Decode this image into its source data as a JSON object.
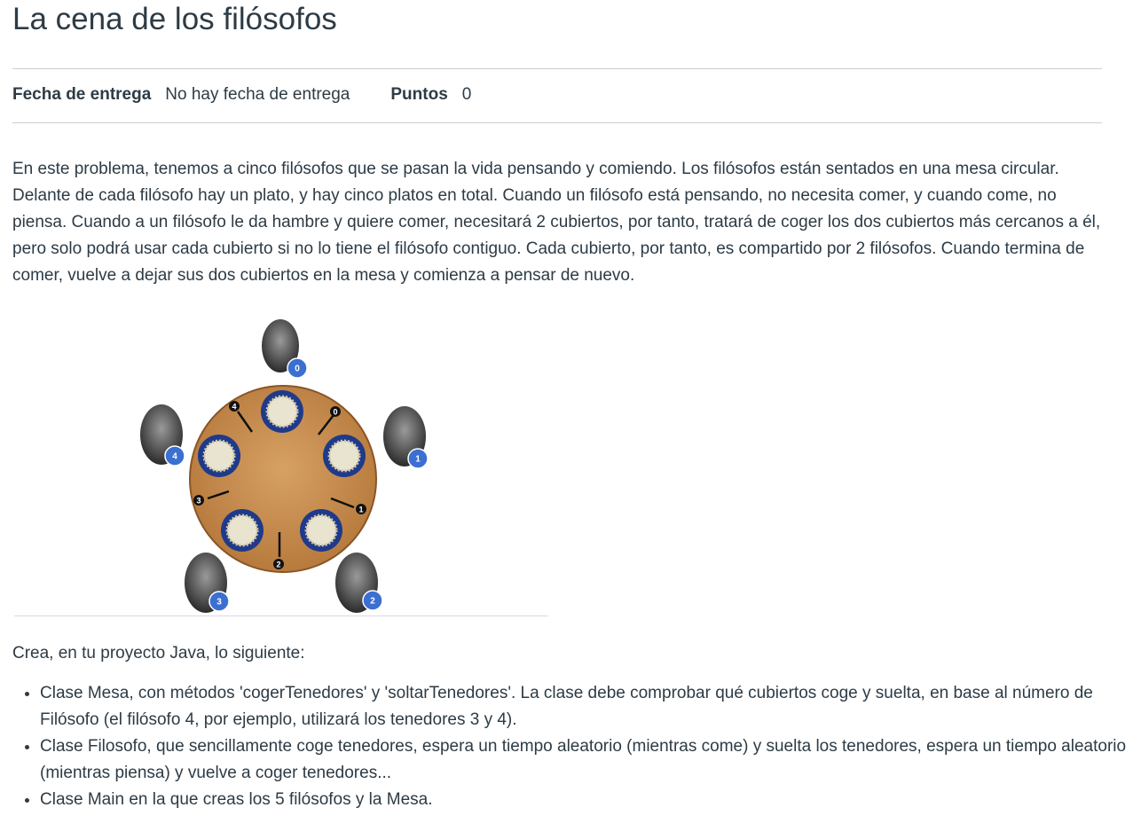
{
  "title": "La cena de los filósofos",
  "meta": {
    "due_label": "Fecha de entrega",
    "due_value": "No hay fecha de entrega",
    "points_label": "Puntos",
    "points_value": "0"
  },
  "intro": "En este problema, tenemos a cinco filósofos que se pasan la vida pensando y comiendo. Los filósofos están sentados en una mesa circular. Delante de cada filósofo hay un plato, y hay cinco platos en total. Cuando un filósofo está pensando, no necesita comer, y cuando come, no piensa. Cuando a un filósofo le da hambre y quiere comer, necesitará 2 cubiertos, por tanto, tratará de coger los dos cubiertos más cercanos a él, pero solo podrá usar cada cubierto si no lo tiene el filósofo contiguo. Cada cubierto, por tanto, es compartido por 2 filósofos. Cuando termina de comer, vuelve a dejar sus dos cubiertos en la mesa y comienza a pensar de nuevo.",
  "figure": {
    "philosophers": [
      "0",
      "1",
      "2",
      "3",
      "4"
    ],
    "forks": [
      "0",
      "1",
      "2",
      "3",
      "4"
    ],
    "colors": {
      "table": "#c48a4e",
      "plate": "#1f3a8a",
      "badge": "#3b6fd1"
    }
  },
  "crea": "Crea, en tu proyecto Java, lo siguiente:",
  "tasks": [
    "Clase Mesa, con métodos 'cogerTenedores' y 'soltarTenedores'. La clase debe comprobar qué cubiertos coge y suelta, en base al número de Filósofo (el filósofo 4, por ejemplo, utilizará los tenedores 3 y 4).",
    "Clase Filosofo, que sencillamente coge tenedores, espera un tiempo aleatorio (mientras come) y suelta los tenedores, espera un tiempo aleatorio (mientras piensa) y vuelve a coger tenedores...",
    "Clase Main en la que creas los 5 filósofos y la Mesa."
  ]
}
